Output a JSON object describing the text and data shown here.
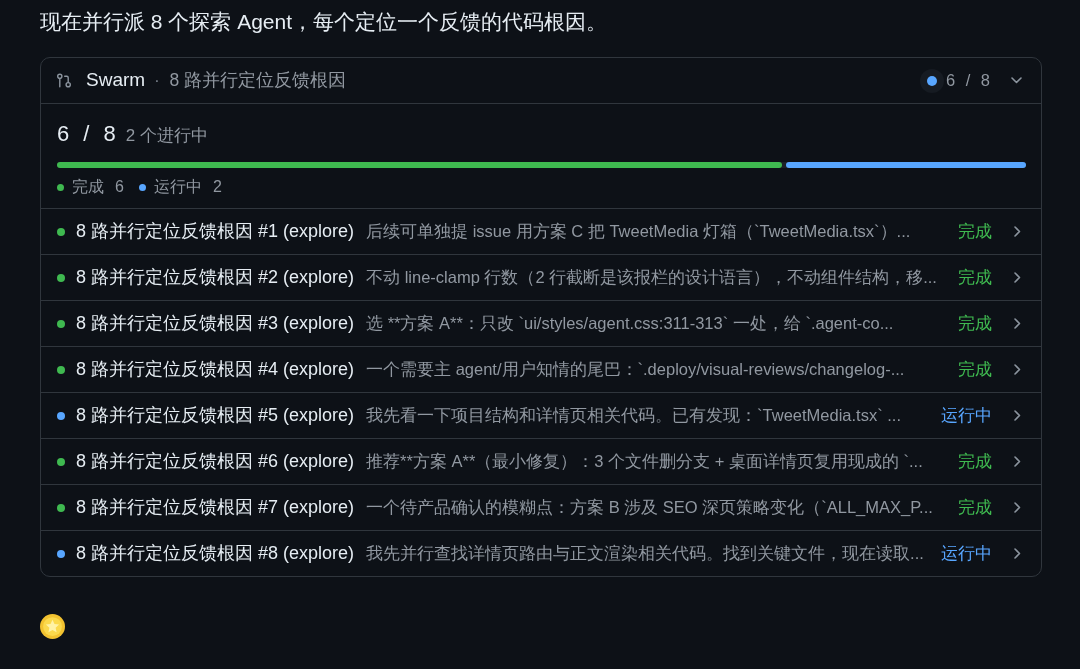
{
  "intro": "现在并行派 8 个探索 Agent，每个定位一个反馈的代码根因。",
  "panel": {
    "expanded": true,
    "title": "Swarm",
    "separator": "·",
    "subtitle": "8 路并行定位反馈根因",
    "indicator": {
      "color": "#58a6ff",
      "count": "6 / 8"
    },
    "summary": {
      "count": "6 / 8",
      "note": "2 个进行中"
    },
    "progress": [
      {
        "level": 0.75,
        "color": "#3fb950"
      },
      {
        "level": 0.25,
        "color": "#58a6ff"
      }
    ],
    "legend": [
      {
        "label": "完成",
        "count": "6",
        "color": "#3fb950"
      },
      {
        "label": "运行中",
        "count": "2",
        "color": "#58a6ff"
      }
    ],
    "agents": [
      {
        "title": "8 路并行定位反馈根因 #1 (explore)",
        "summary": "后续可单独提 issue 用方案 C 把 TweetMedia 灯箱（`TweetMedia.tsx`）...",
        "status": "完成",
        "color": "#3fb950"
      },
      {
        "title": "8 路并行定位反馈根因 #2 (explore)",
        "summary": "不动 line-clamp 行数（2 行截断是该报栏的设计语言），不动组件结构，移...",
        "status": "完成",
        "color": "#3fb950"
      },
      {
        "title": "8 路并行定位反馈根因 #3 (explore)",
        "summary": "选 **方案 A**：只改 `ui/styles/agent.css:311-313` 一处，给 `.agent-co...",
        "status": "完成",
        "color": "#3fb950"
      },
      {
        "title": "8 路并行定位反馈根因 #4 (explore)",
        "summary": "一个需要主 agent/用户知情的尾巴：`.deploy/visual-reviews/changelog-...",
        "status": "完成",
        "color": "#3fb950"
      },
      {
        "title": "8 路并行定位反馈根因 #5 (explore)",
        "summary": "我先看一下项目结构和详情页相关代码。已有发现：`TweetMedia.tsx` ...",
        "status": "运行中",
        "color": "#58a6ff"
      },
      {
        "title": "8 路并行定位反馈根因 #6 (explore)",
        "summary": "推荐**方案 A**（最小修复）：3 个文件删分支 + 桌面详情页复用现成的 `...",
        "status": "完成",
        "color": "#3fb950"
      },
      {
        "title": "8 路并行定位反馈根因 #7 (explore)",
        "summary": "一个待产品确认的模糊点：方案 B 涉及 SEO 深页策略变化（`ALL_MAX_P...",
        "status": "完成",
        "color": "#3fb950"
      },
      {
        "title": "8 路并行定位反馈根因 #8 (explore)",
        "summary": "我先并行查找详情页路由与正文渲染相关代码。找到关键文件，现在读取...",
        "status": "运行中",
        "color": "#58a6ff"
      }
    ]
  }
}
